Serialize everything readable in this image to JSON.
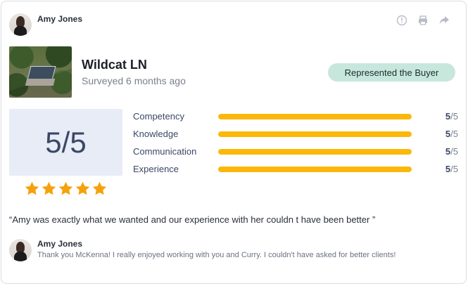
{
  "review": {
    "agent_name": "Amy Jones",
    "property_title": "Wildcat LN",
    "surveyed": "Surveyed 6 months ago",
    "badge": "Represented the Buyer",
    "overall_score": "5/5",
    "star_rating": 5,
    "quote": "“Amy was exactly what we wanted and our experience with her couldn t have been better ”"
  },
  "metrics": [
    {
      "label": "Competency",
      "score": "5",
      "max": "/5",
      "fraction": 1.0
    },
    {
      "label": "Knowledge",
      "score": "5",
      "max": "/5",
      "fraction": 1.0
    },
    {
      "label": "Communication",
      "score": "5",
      "max": "/5",
      "fraction": 1.0
    },
    {
      "label": "Experience",
      "score": "5",
      "max": "/5",
      "fraction": 1.0
    }
  ],
  "reply": {
    "name": "Amy Jones",
    "text": "Thank you McKenna! I really enjoyed working with you and Curry. I couldn't have asked for better clients!"
  },
  "actions": {
    "icons": [
      "info-icon",
      "print-icon",
      "share-icon"
    ]
  },
  "colors": {
    "accent_bar": "#fbb80a",
    "star": "#f6a10c",
    "badge_bg": "#c7e7dd",
    "score_box_bg": "#e8ecf6"
  }
}
